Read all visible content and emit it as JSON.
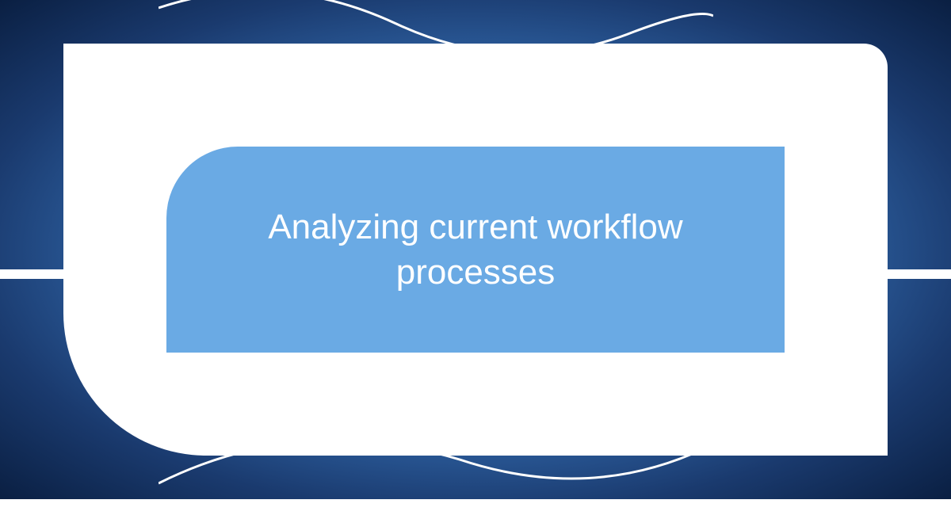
{
  "title": "Analyzing current workflow processes",
  "colors": {
    "background_center": "#5a9bd8",
    "background_edge": "#0a1f42",
    "inner_panel": "#6aaae4",
    "text": "#ffffff",
    "outer_panel": "#ffffff"
  }
}
